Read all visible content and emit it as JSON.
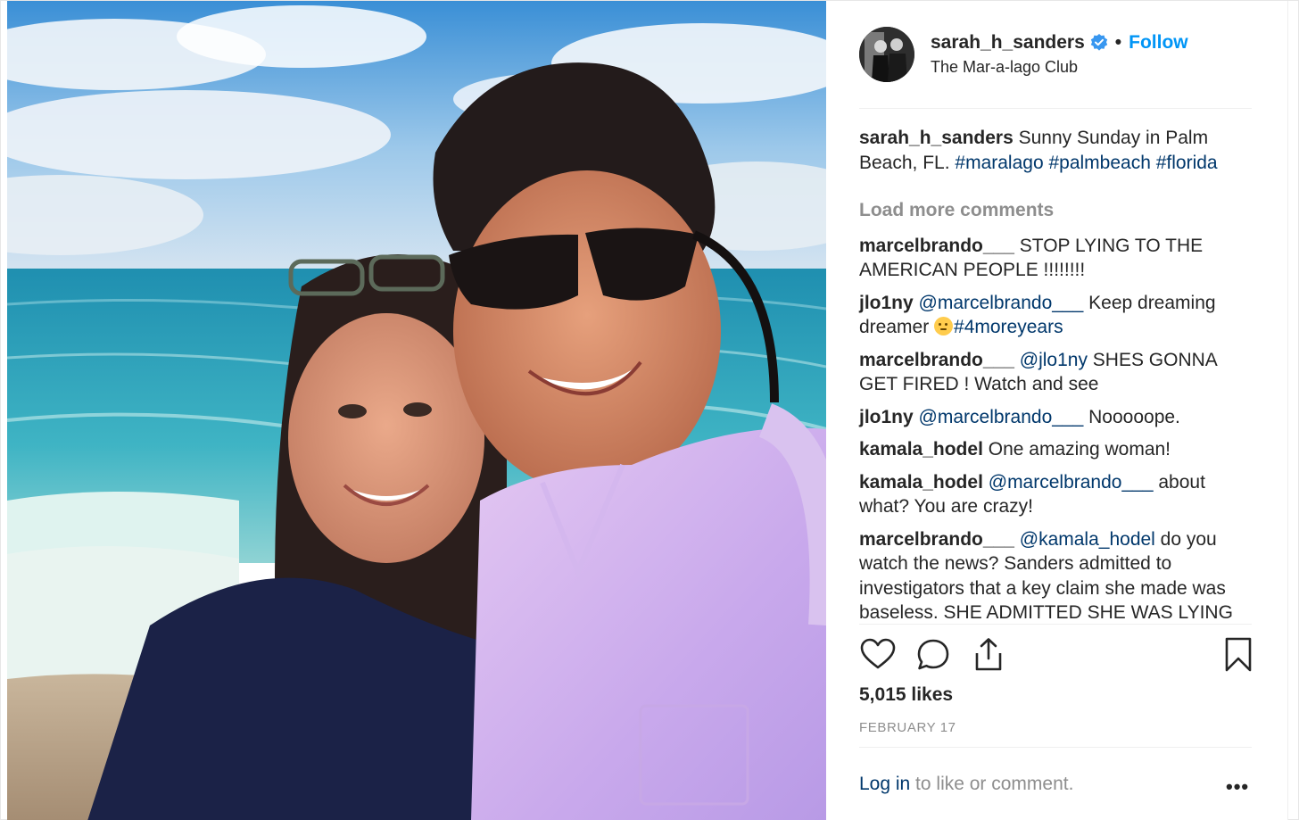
{
  "post": {
    "username": "sarah_h_sanders",
    "separator": "•",
    "follow_label": "Follow",
    "location": "The Mar-a-lago Club",
    "caption": {
      "user": "sarah_h_sanders",
      "text": " Sunny Sunday in Palm Beach, FL. ",
      "tags": [
        "#maralago",
        "#palmbeach",
        "#florida"
      ]
    },
    "load_more": "Load more comments",
    "comments": [
      {
        "user": "marcelbrando___",
        "mention": "",
        "text": " STOP LYING TO THE AMERICAN PEOPLE !!!!!!!!"
      },
      {
        "user": "jlo1ny",
        "mention": "@marcelbrando___",
        "text": " Keep dreaming dreamer ",
        "emoji": "rolling-eyes-emoji",
        "tag": "#4moreyears"
      },
      {
        "user": "marcelbrando___",
        "mention": "@jlo1ny",
        "text": " SHES GONNA GET FIRED ! Watch and see"
      },
      {
        "user": "jlo1ny",
        "mention": "@marcelbrando___",
        "text": " Nooooope."
      },
      {
        "user": "kamala_hodel",
        "mention": "",
        "text": " One amazing woman!"
      },
      {
        "user": "kamala_hodel",
        "mention": "@marcelbrando___",
        "text": " about what? You are crazy!"
      },
      {
        "user": "marcelbrando___",
        "mention": "@kamala_hodel",
        "text": " do you watch the news? Sanders admitted to investigators that a key claim she made was baseless. SHE ADMITTED SHE WAS LYING"
      }
    ],
    "likes": "5,015 likes",
    "date": "FEBRUARY 17",
    "login_link": "Log in",
    "login_text": " to like or comment.",
    "more_label": "•••"
  },
  "icons": {
    "verified": "verified-badge-icon",
    "like": "heart-icon",
    "comment": "comment-bubble-icon",
    "share": "share-icon",
    "save": "bookmark-icon",
    "more": "more-options-icon"
  },
  "colors": {
    "follow": "#0095f6",
    "tag": "#00376b",
    "muted": "#8e8e8e",
    "text": "#262626",
    "verified": "#3897f0"
  }
}
